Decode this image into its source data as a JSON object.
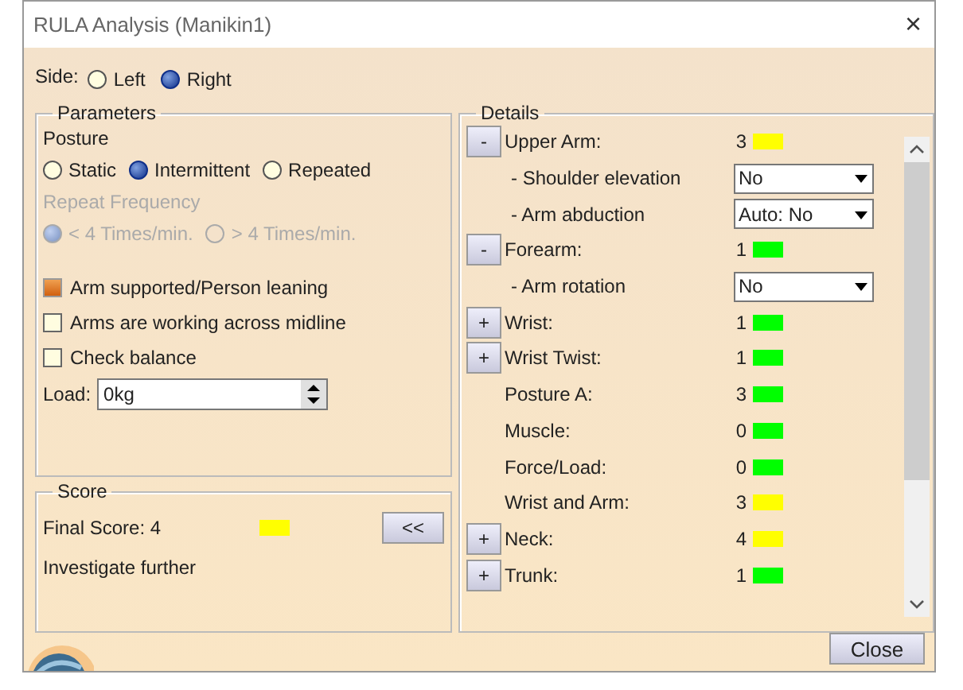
{
  "window": {
    "title": "RULA Analysis (Manikin1)",
    "close_glyph": "×"
  },
  "side": {
    "label": "Side:",
    "options": [
      {
        "label": "Left",
        "selected": false
      },
      {
        "label": "Right",
        "selected": true
      }
    ]
  },
  "parameters": {
    "title": "Parameters",
    "posture_label": "Posture",
    "posture": [
      {
        "label": "Static",
        "selected": false
      },
      {
        "label": "Intermittent",
        "selected": true
      },
      {
        "label": "Repeated",
        "selected": false
      }
    ],
    "frequency_label": "Repeat Frequency",
    "frequency_disabled": true,
    "frequency": [
      {
        "label": "< 4 Times/min.",
        "selected": true
      },
      {
        "label": "> 4 Times/min.",
        "selected": false
      }
    ],
    "checks": [
      {
        "label": "Arm supported/Person leaning",
        "checked": true
      },
      {
        "label": "Arms are working across midline",
        "checked": false
      },
      {
        "label": "Check balance",
        "checked": false
      }
    ],
    "load": {
      "label": "Load:",
      "value": "0kg"
    }
  },
  "score": {
    "title": "Score",
    "final": "Final Score: 4",
    "color": "#ffff00",
    "verdict": "Investigate further",
    "button": "<<"
  },
  "details": {
    "title": "Details",
    "rows": [
      {
        "kind": "score",
        "toggle": "-",
        "label": "Upper Arm:",
        "value": "3",
        "color": "#ffff00"
      },
      {
        "kind": "dropdown",
        "label": "- Shoulder elevation",
        "value": "No"
      },
      {
        "kind": "dropdown",
        "label": "- Arm abduction",
        "value": "Auto: No"
      },
      {
        "kind": "score",
        "toggle": "-",
        "label": "Forearm:",
        "value": "1",
        "color": "#00ff00"
      },
      {
        "kind": "dropdown",
        "label": "- Arm rotation",
        "value": "No"
      },
      {
        "kind": "score",
        "toggle": "+",
        "label": "Wrist:",
        "value": "1",
        "color": "#00ff00"
      },
      {
        "kind": "score",
        "toggle": "+",
        "label": "Wrist Twist:",
        "value": "1",
        "color": "#00ff00"
      },
      {
        "kind": "score",
        "label": "Posture A:",
        "value": "3",
        "color": "#00ff00"
      },
      {
        "kind": "score",
        "label": "Muscle:",
        "value": "0",
        "color": "#00ff00"
      },
      {
        "kind": "score",
        "label": "Force/Load:",
        "value": "0",
        "color": "#00ff00"
      },
      {
        "kind": "score",
        "label": "Wrist and Arm:",
        "value": "3",
        "color": "#ffff00"
      },
      {
        "kind": "score",
        "toggle": "+",
        "label": "Neck:",
        "value": "4",
        "color": "#ffff00"
      },
      {
        "kind": "score",
        "toggle": "+",
        "label": "Trunk:",
        "value": "1",
        "color": "#00ff00"
      }
    ]
  },
  "close_button": "Close"
}
